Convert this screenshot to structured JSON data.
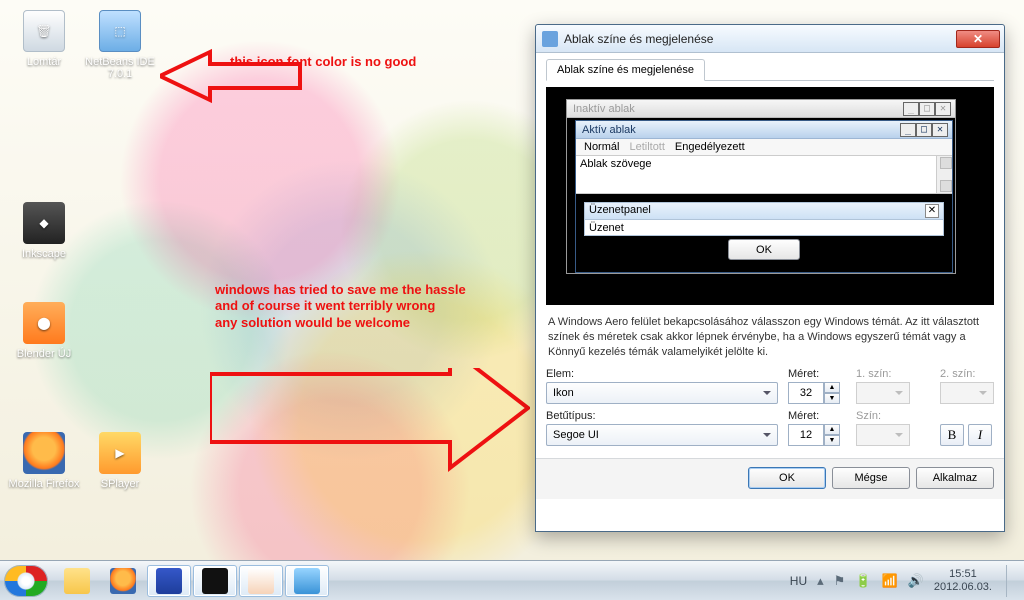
{
  "desktop": {
    "icons": {
      "recycle": "Lomtár",
      "netbeans": "NetBeans IDE 7.0.1",
      "inkscape": "Inkscape",
      "blender": "Blender ÚJ",
      "firefox": "Mozilla Firefox",
      "splayer": "SPlayer"
    }
  },
  "annotations": {
    "text1": "this icon font color is no good",
    "text2": "windows has tried to save me the hassle and of course it went terribly wrong\nany solution would be welcome"
  },
  "dialog": {
    "title": "Ablak színe és megjelenése",
    "tab": "Ablak színe és megjelenése",
    "preview": {
      "inactive_title": "Inaktív ablak",
      "active_title": "Aktív ablak",
      "menu_normal": "Normál",
      "menu_disabled": "Letiltott",
      "menu_selected": "Engedélyezett",
      "window_text": "Ablak szövege",
      "msgpanel_title": "Üzenetpanel",
      "msg_text": "Üzenet",
      "ok": "OK"
    },
    "description": "A Windows Aero felület bekapcsolásához válasszon egy Windows témát. Az itt választott színek és méretek csak akkor lépnek érvénybe, ha a Windows egyszerű témát vagy a Könnyű kezelés témák valamelyikét jelölte ki.",
    "labels": {
      "elem": "Elem:",
      "meret": "Méret:",
      "szin1": "1. szín:",
      "szin2": "2. szín:",
      "betutipus": "Betűtípus:",
      "meret2": "Méret:",
      "szin": "Szín:"
    },
    "values": {
      "elem": "Ikon",
      "size1": "32",
      "font": "Segoe UI",
      "size2": "12",
      "bold": "B",
      "italic": "I"
    },
    "buttons": {
      "ok": "OK",
      "cancel": "Mégse",
      "apply": "Alkalmaz"
    }
  },
  "taskbar": {
    "lang": "HU",
    "time": "15:51",
    "date": "2012.06.03."
  }
}
